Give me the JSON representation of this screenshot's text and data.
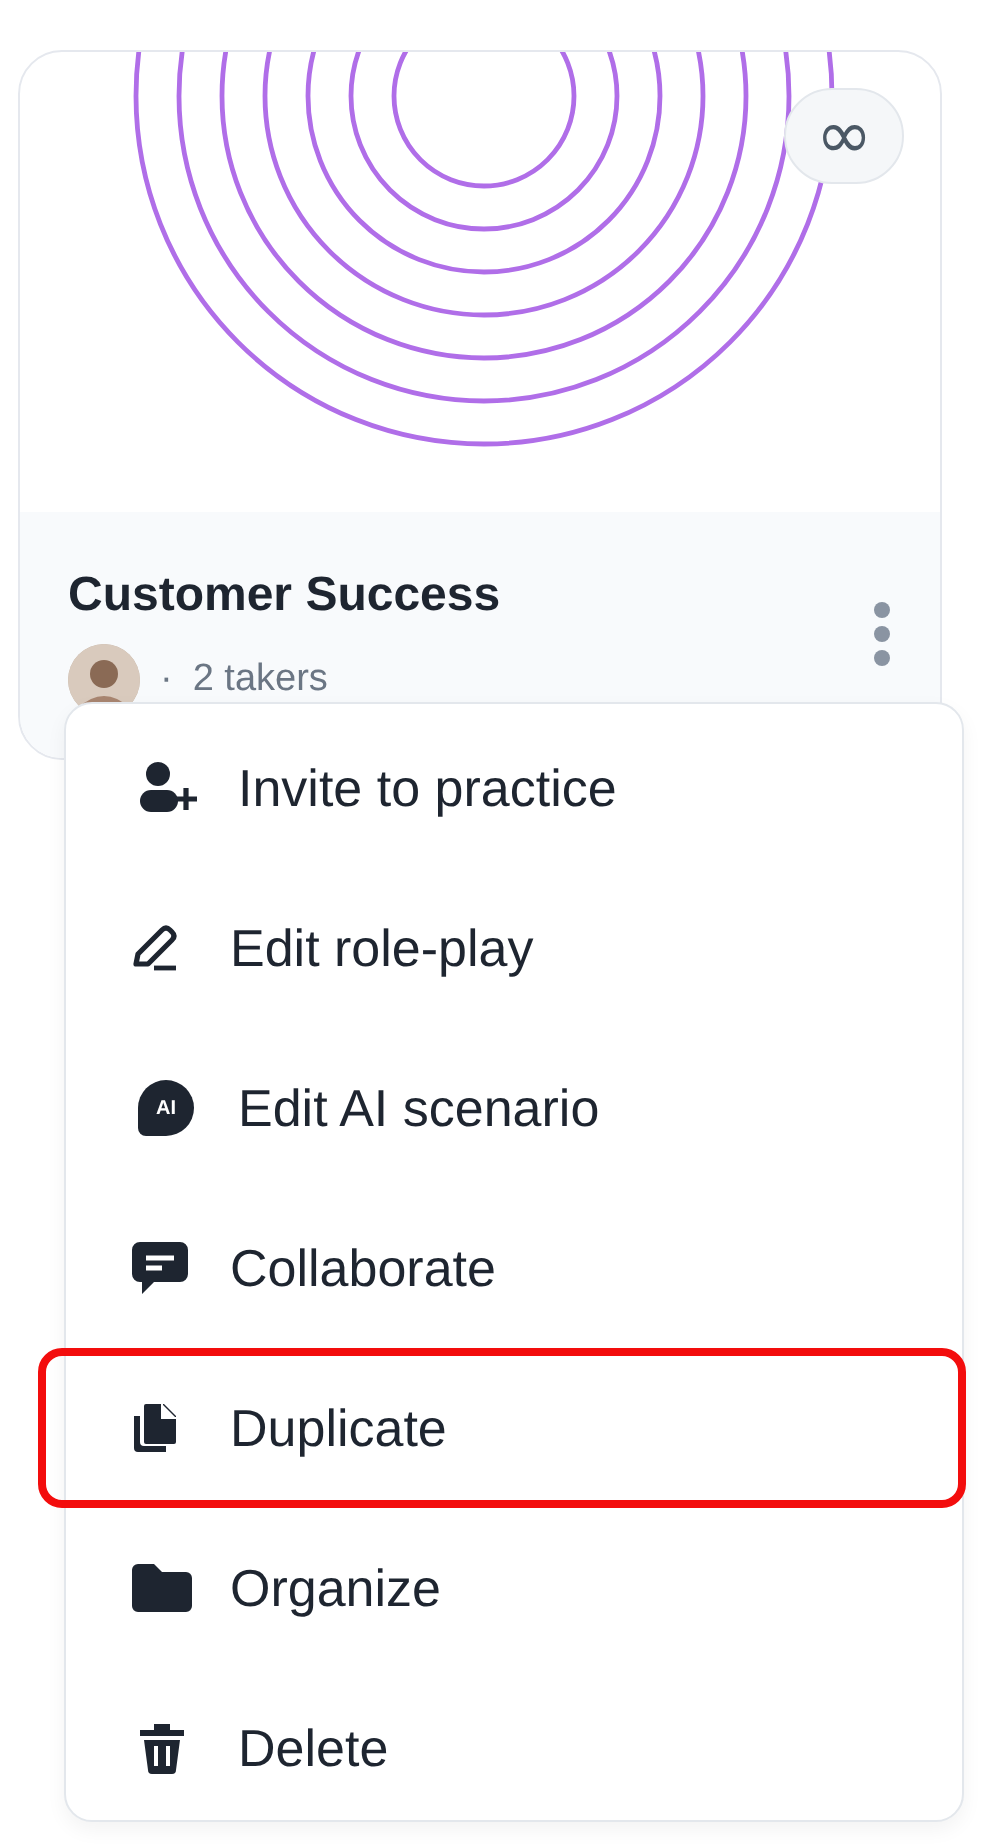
{
  "card": {
    "badge": "∞",
    "title": "Customer Success",
    "separator": "·",
    "takers": "2 takers"
  },
  "menu": {
    "items": [
      {
        "label": "Invite to practice",
        "highlighted": false
      },
      {
        "label": "Edit role-play",
        "highlighted": false
      },
      {
        "label": "Edit AI scenario",
        "highlighted": false,
        "icon_text": "AI"
      },
      {
        "label": "Collaborate",
        "highlighted": false
      },
      {
        "label": "Duplicate",
        "highlighted": true
      },
      {
        "label": "Organize",
        "highlighted": false
      },
      {
        "label": "Delete",
        "highlighted": false
      }
    ]
  }
}
